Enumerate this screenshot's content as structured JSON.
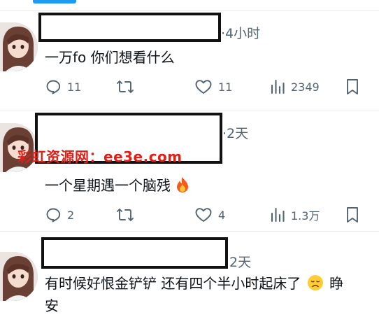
{
  "watermark": "彩虹资源网：ee3e.com",
  "posts": [
    {
      "meta": "·4小时",
      "text": "一万fo 你们想看什么",
      "actions": {
        "reply": "11",
        "retweet": "",
        "like": "11",
        "views": "2349"
      }
    },
    {
      "meta": "·2天",
      "text": "一个星期遇一个脑残",
      "emoji": "fire",
      "actions": {
        "reply": "2",
        "retweet": "",
        "like": "4",
        "views": "1.3万"
      }
    },
    {
      "meta": "2天",
      "text": "有时候好恨金铲铲 还有四个半小时起床了",
      "text_end": "睁",
      "text_line2": "安",
      "emoji": "disappointed-face"
    }
  ],
  "icons": [
    "reply-icon",
    "retweet-icon",
    "like-icon",
    "views-icon",
    "bookmark-icon"
  ],
  "colors": {
    "accent": "#1d9bf0",
    "muted": "#536471",
    "watermark": "#e02018"
  }
}
